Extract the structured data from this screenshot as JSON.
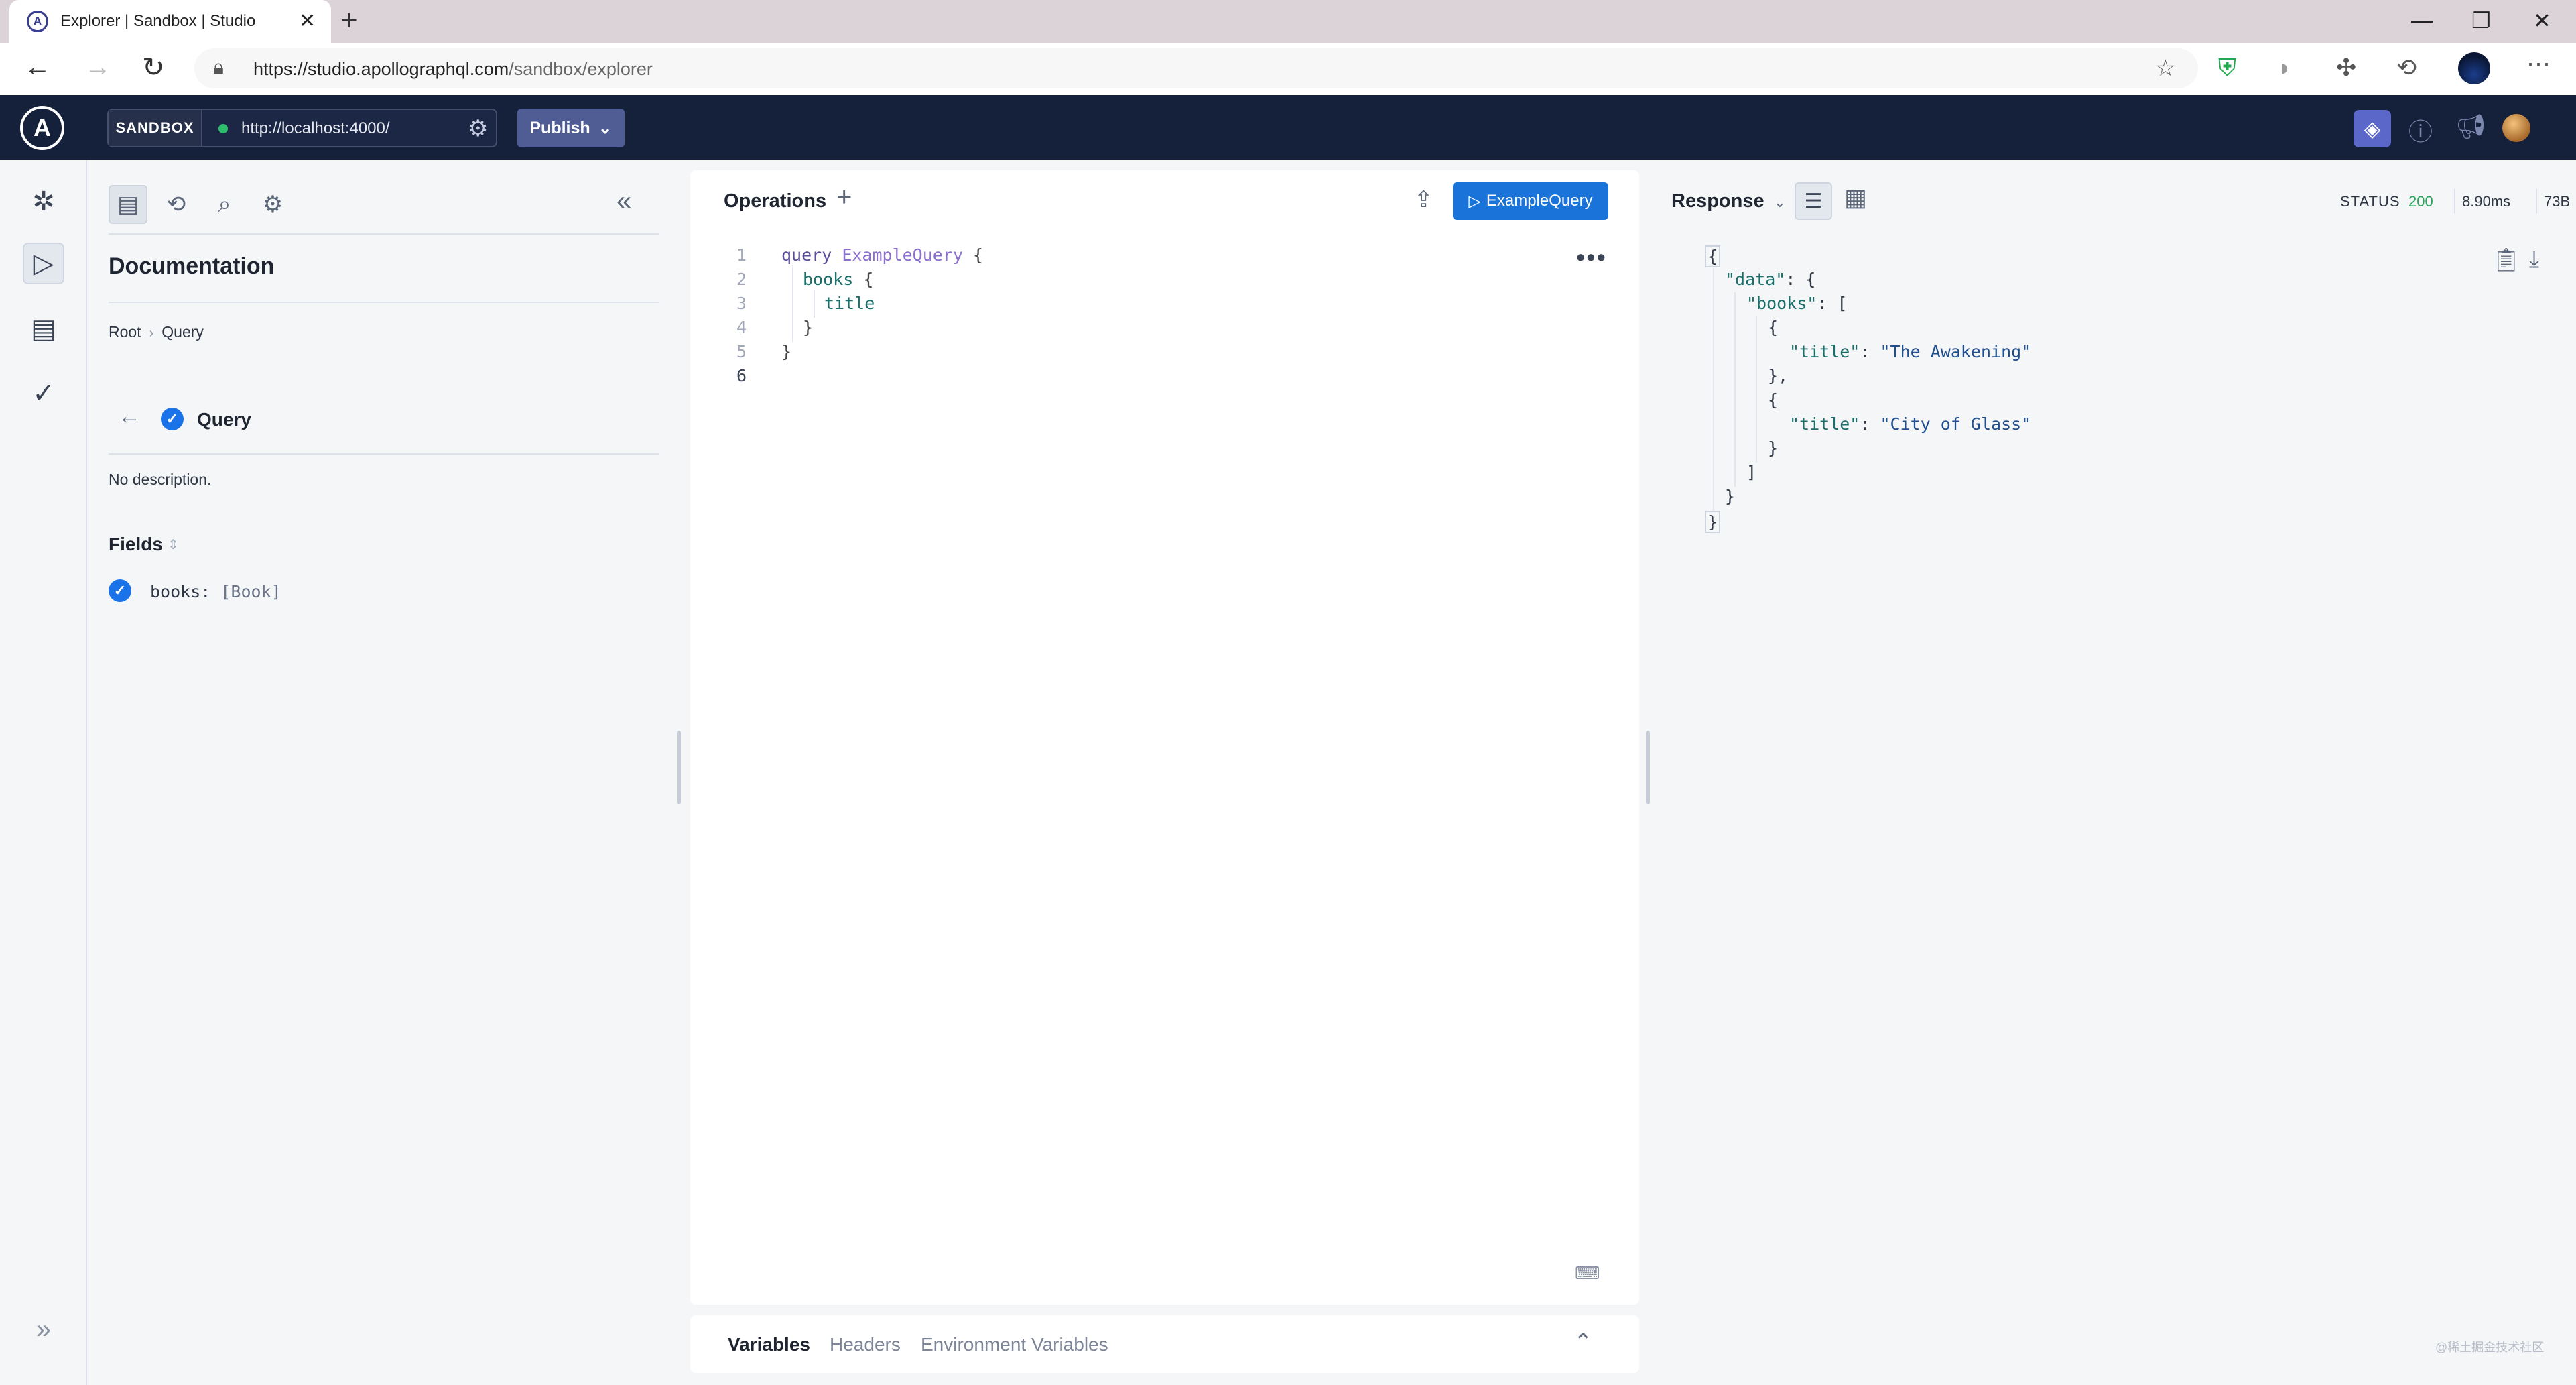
{
  "browser": {
    "tab_title": "Explorer | Sandbox | Studio",
    "tab_close": "✕",
    "new_tab": "+",
    "url_host": "https://studio.apollographql.com",
    "url_path": "/sandbox/explorer",
    "window_controls": [
      "minimize-icon",
      "restore-icon",
      "close-icon"
    ]
  },
  "header": {
    "logo_text": "A",
    "sandbox_label": "SANDBOX",
    "endpoint": "http://localhost:4000/",
    "publish_label": "Publish",
    "icons": [
      "explorer-icon",
      "help-icon",
      "announcements-icon",
      "avatar"
    ]
  },
  "rail": {
    "items": [
      "schema-icon",
      "explorer-icon",
      "checks-icon",
      "launches-icon"
    ],
    "expand_icon": "expand-icon"
  },
  "documentation": {
    "title": "Documentation",
    "breadcrumb": [
      "Root",
      "Query"
    ],
    "type_name": "Query",
    "description": "No description.",
    "fields_title": "Fields",
    "fields": [
      {
        "name": "books:",
        "type": "[Book]",
        "selected": true
      }
    ]
  },
  "operations": {
    "title": "Operations",
    "run_label": "ExampleQuery",
    "line_numbers": [
      "1",
      "2",
      "3",
      "4",
      "5",
      "6"
    ],
    "code": {
      "keyword": "query",
      "operation_name": "ExampleQuery",
      "field_books": "books",
      "field_title": "title"
    }
  },
  "variables_bar": {
    "tabs": [
      "Variables",
      "Headers",
      "Environment Variables"
    ]
  },
  "response": {
    "title": "Response",
    "status_label": "STATUS",
    "status_code": "200",
    "time": "8.90ms",
    "size": "73B",
    "data_key": "\"data\"",
    "books_key": "\"books\"",
    "title_key": "\"title\"",
    "items": [
      "\"The Awakening\"",
      "\"City of Glass\""
    ]
  },
  "watermark": "@稀土掘金技术社区",
  "colors": {
    "header_bg": "#15203b",
    "run_button": "#1a73d9",
    "status_ok": "#27a35a",
    "publish_button": "#4f5d94"
  }
}
